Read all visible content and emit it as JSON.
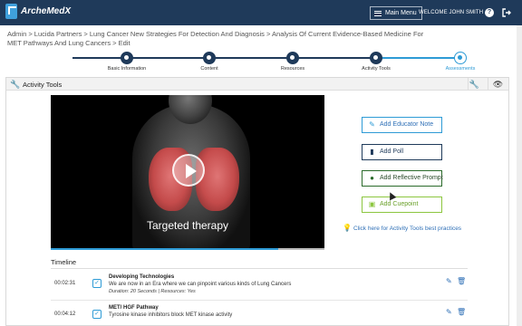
{
  "header": {
    "logo_text": "ArcheMedX",
    "main_menu_label": "Main Menu",
    "welcome_text": "WELCOME  JOHN SMITH",
    "help_icon": "?",
    "brand_color": "#1f3a5a",
    "accent_color": "#2e9bd6"
  },
  "breadcrumb": "Admin > Lucida Partners > Lung Cancer New Strategies For Detection And Diagnosis > Analysis Of Current Evidence-Based Medicine For MET Pathways And Lung Cancers > Edit",
  "stepper": {
    "steps": [
      {
        "label": "Basic Information",
        "state": "complete"
      },
      {
        "label": "Content",
        "state": "complete"
      },
      {
        "label": "Resources",
        "state": "complete"
      },
      {
        "label": "Activity Tools",
        "state": "complete"
      },
      {
        "label": "Assessments",
        "state": "active"
      }
    ]
  },
  "panel": {
    "title": "Activity Tools",
    "wrench_icon": "🔧",
    "eye_icon": "👁"
  },
  "video": {
    "caption": "Targeted therapy",
    "progress_percent": 83
  },
  "activity_buttons": {
    "educator_note": "Add Educator Note",
    "poll": "Add Poll",
    "reflective_prompt": "Add Reflective Prompt",
    "cuepoint": "Add Cuepoint"
  },
  "tips_link": "Click here for Activity Tools best practices",
  "timeline": {
    "title": "Timeline",
    "entries": [
      {
        "time": "00:02:31",
        "title": "Developing Technologies",
        "description": "We are now in an Era where we can pinpoint various kinds of Lung Cancers",
        "meta": "Duration: 20 Seconds | Resources: Yes"
      },
      {
        "time": "00:04:12",
        "title": "MET/ HGF Pathway",
        "description": "Tyrosine kinase inhibitors block MET kinase activity",
        "meta": ""
      }
    ]
  }
}
